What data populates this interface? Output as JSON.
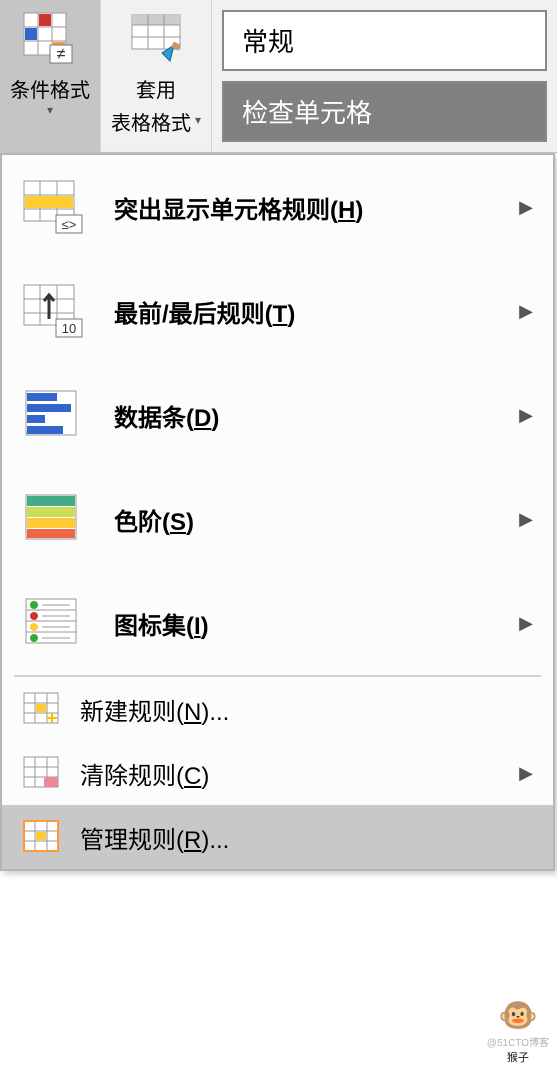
{
  "ribbon": {
    "cond_format": {
      "label": "条件格式"
    },
    "table_format": {
      "label1": "套用",
      "label2": "表格格式"
    },
    "style_normal": "常规",
    "style_check": "检查单元格"
  },
  "menu": {
    "highlight": {
      "label_pre": "突出显示单元格规则(",
      "key": "H",
      "label_post": ")"
    },
    "toprules": {
      "label_pre": "最前/最后规则(",
      "key": "T",
      "label_post": ")"
    },
    "databars": {
      "label_pre": "数据条(",
      "key": "D",
      "label_post": ")"
    },
    "colorscales": {
      "label_pre": "色阶(",
      "key": "S",
      "label_post": ")"
    },
    "iconsets": {
      "label_pre": "图标集(",
      "key": "I",
      "label_post": ")"
    },
    "newrule": {
      "label_pre": "新建规则(",
      "key": "N",
      "label_post": ")..."
    },
    "clearrules": {
      "label_pre": "清除规则(",
      "key": "C",
      "label_post": ")"
    },
    "managerules": {
      "label_pre": "管理规则(",
      "key": "R",
      "label_post": ")..."
    }
  },
  "watermark": {
    "line1": "@51CTO博客",
    "label": "猴子"
  }
}
